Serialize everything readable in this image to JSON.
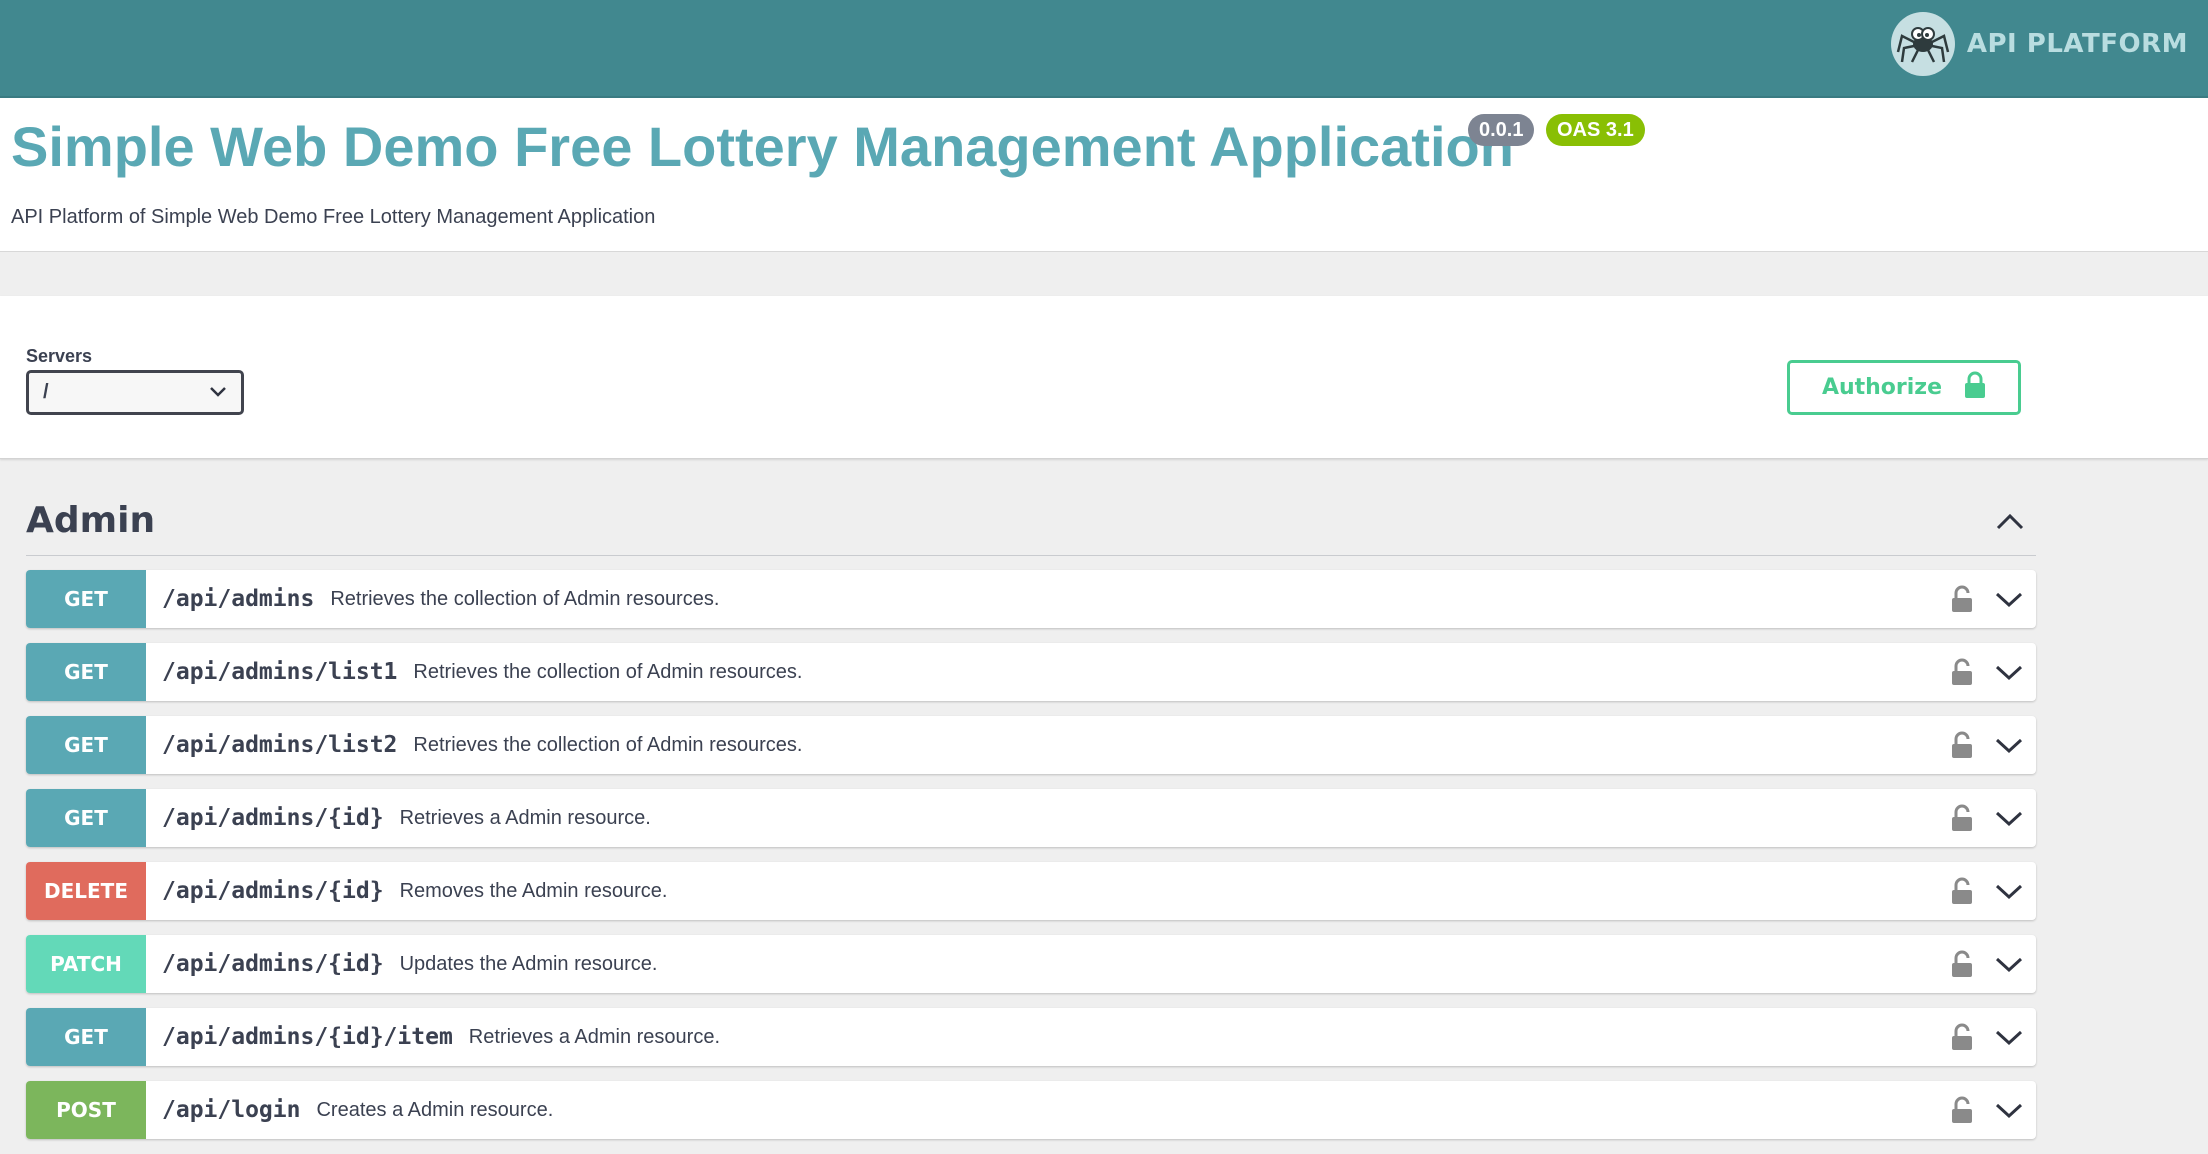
{
  "topbar": {
    "brand_text": "API PLATFORM",
    "logo_icon": "spider-icon"
  },
  "info": {
    "title": "Simple Web Demo Free Lottery Management Application",
    "version_badge": "0.0.1",
    "oas_badge": "OAS 3.1",
    "description": "API Platform of Simple Web Demo Free Lottery Management Application"
  },
  "servers": {
    "label": "Servers",
    "selected": "/"
  },
  "authorize": {
    "label": "Authorize",
    "icon": "lock-icon"
  },
  "tag": {
    "name": "Admin",
    "toggle_icon": "chevron-up-icon"
  },
  "colors": {
    "get": "#5aa8b4",
    "delete": "#e06b5d",
    "patch": "#63d9b8",
    "post": "#7cb65c",
    "accent": "#41888f"
  },
  "operations": [
    {
      "method": "GET",
      "path": "/api/admins",
      "summary": "Retrieves the collection of Admin resources."
    },
    {
      "method": "GET",
      "path": "/api/admins/list1",
      "summary": "Retrieves the collection of Admin resources."
    },
    {
      "method": "GET",
      "path": "/api/admins/list2",
      "summary": "Retrieves the collection of Admin resources."
    },
    {
      "method": "GET",
      "path": "/api/admins/{id}",
      "summary": "Retrieves a Admin resource."
    },
    {
      "method": "DELETE",
      "path": "/api/admins/{id}",
      "summary": "Removes the Admin resource."
    },
    {
      "method": "PATCH",
      "path": "/api/admins/{id}",
      "summary": "Updates the Admin resource."
    },
    {
      "method": "GET",
      "path": "/api/admins/{id}/item",
      "summary": "Retrieves a Admin resource."
    },
    {
      "method": "POST",
      "path": "/api/login",
      "summary": "Creates a Admin resource."
    }
  ]
}
